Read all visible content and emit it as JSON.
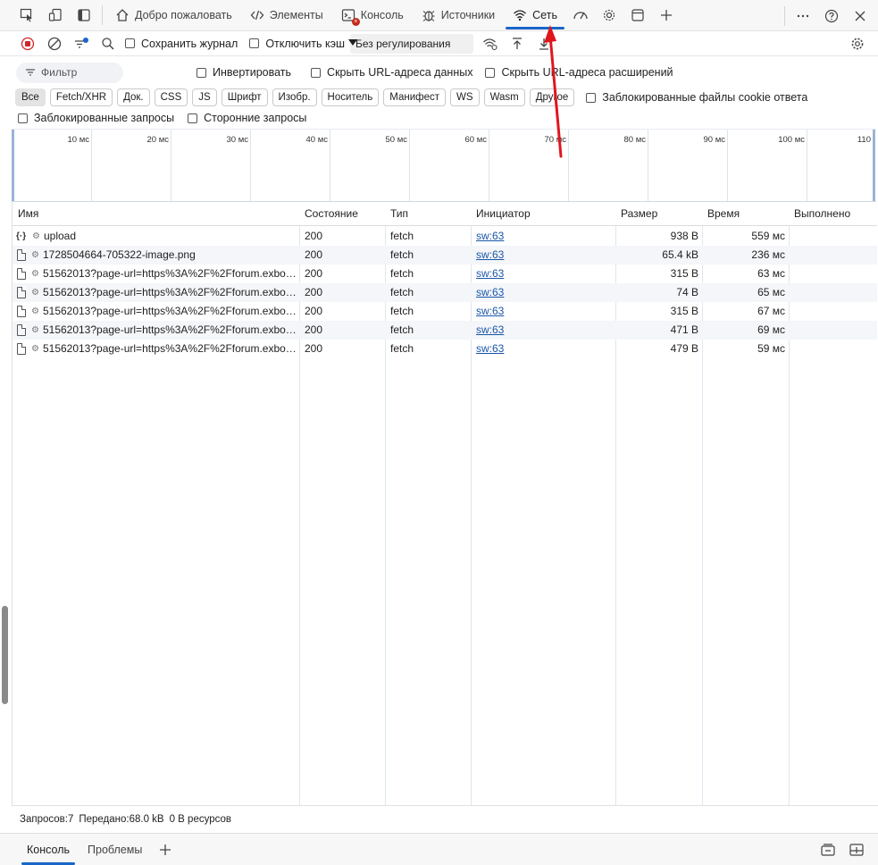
{
  "tabs": {
    "welcome": "Добро пожаловать",
    "elements": "Элементы",
    "console": "Консоль",
    "sources": "Источники",
    "network": "Сеть"
  },
  "toolbar": {
    "preserve_log": "Сохранить журнал",
    "disable_cache": "Отключить кэш",
    "throttling": "Без регулирования"
  },
  "filter": {
    "placeholder": "Фильтр",
    "invert": "Инвертировать",
    "hide_data_urls": "Скрыть URL-адреса данных",
    "hide_extension_urls": "Скрыть URL-адреса расширений"
  },
  "types": [
    "Все",
    "Fetch/XHR",
    "Док.",
    "CSS",
    "JS",
    "Шрифт",
    "Изобр.",
    "Носитель",
    "Манифест",
    "WS",
    "Wasm",
    "Другое"
  ],
  "blocked_cookies": "Заблокированные файлы cookie ответа",
  "blocked_requests": "Заблокированные запросы",
  "third_party": "Сторонние запросы",
  "overview_ticks": [
    "10 мс",
    "20 мс",
    "30 мс",
    "40 мс",
    "50 мс",
    "60 мс",
    "70 мс",
    "80 мс",
    "90 мс",
    "100 мс",
    "110"
  ],
  "columns": {
    "name": "Имя",
    "status": "Состояние",
    "type": "Тип",
    "initiator": "Инициатор",
    "size": "Размер",
    "time": "Время",
    "fulfilled": "Выполнено"
  },
  "rows": [
    {
      "icon": "json",
      "name": "upload",
      "status": "200",
      "type": "fetch",
      "initiator": "sw:63",
      "size": "938 B",
      "time": "559 мс"
    },
    {
      "icon": "file",
      "name": "1728504664-705322-image.png",
      "status": "200",
      "type": "fetch",
      "initiator": "sw:63",
      "size": "65.4 kB",
      "time": "236 мс"
    },
    {
      "icon": "file",
      "name": "51562013?page-url=https%3A%2F%2Fforum.exbo…",
      "status": "200",
      "type": "fetch",
      "initiator": "sw:63",
      "size": "315 B",
      "time": "63 мс"
    },
    {
      "icon": "file",
      "name": "51562013?page-url=https%3A%2F%2Fforum.exbo…",
      "status": "200",
      "type": "fetch",
      "initiator": "sw:63",
      "size": "74 B",
      "time": "65 мс"
    },
    {
      "icon": "file",
      "name": "51562013?page-url=https%3A%2F%2Fforum.exbo…",
      "status": "200",
      "type": "fetch",
      "initiator": "sw:63",
      "size": "315 B",
      "time": "67 мс"
    },
    {
      "icon": "file",
      "name": "51562013?page-url=https%3A%2F%2Fforum.exbo…",
      "status": "200",
      "type": "fetch",
      "initiator": "sw:63",
      "size": "471 B",
      "time": "69 мс"
    },
    {
      "icon": "file",
      "name": "51562013?page-url=https%3A%2F%2Fforum.exbo…",
      "status": "200",
      "type": "fetch",
      "initiator": "sw:63",
      "size": "479 B",
      "time": "59 мс"
    }
  ],
  "status_bar": {
    "requests": "Запросов:7",
    "transferred": "Передано:68.0 kB",
    "resources": "0 B ресурсов"
  },
  "drawer": {
    "console": "Консоль",
    "issues": "Проблемы"
  },
  "colors": {
    "accent": "#1a66c8",
    "annotation_arrow": "#e0161d",
    "record": "#d1262b"
  }
}
